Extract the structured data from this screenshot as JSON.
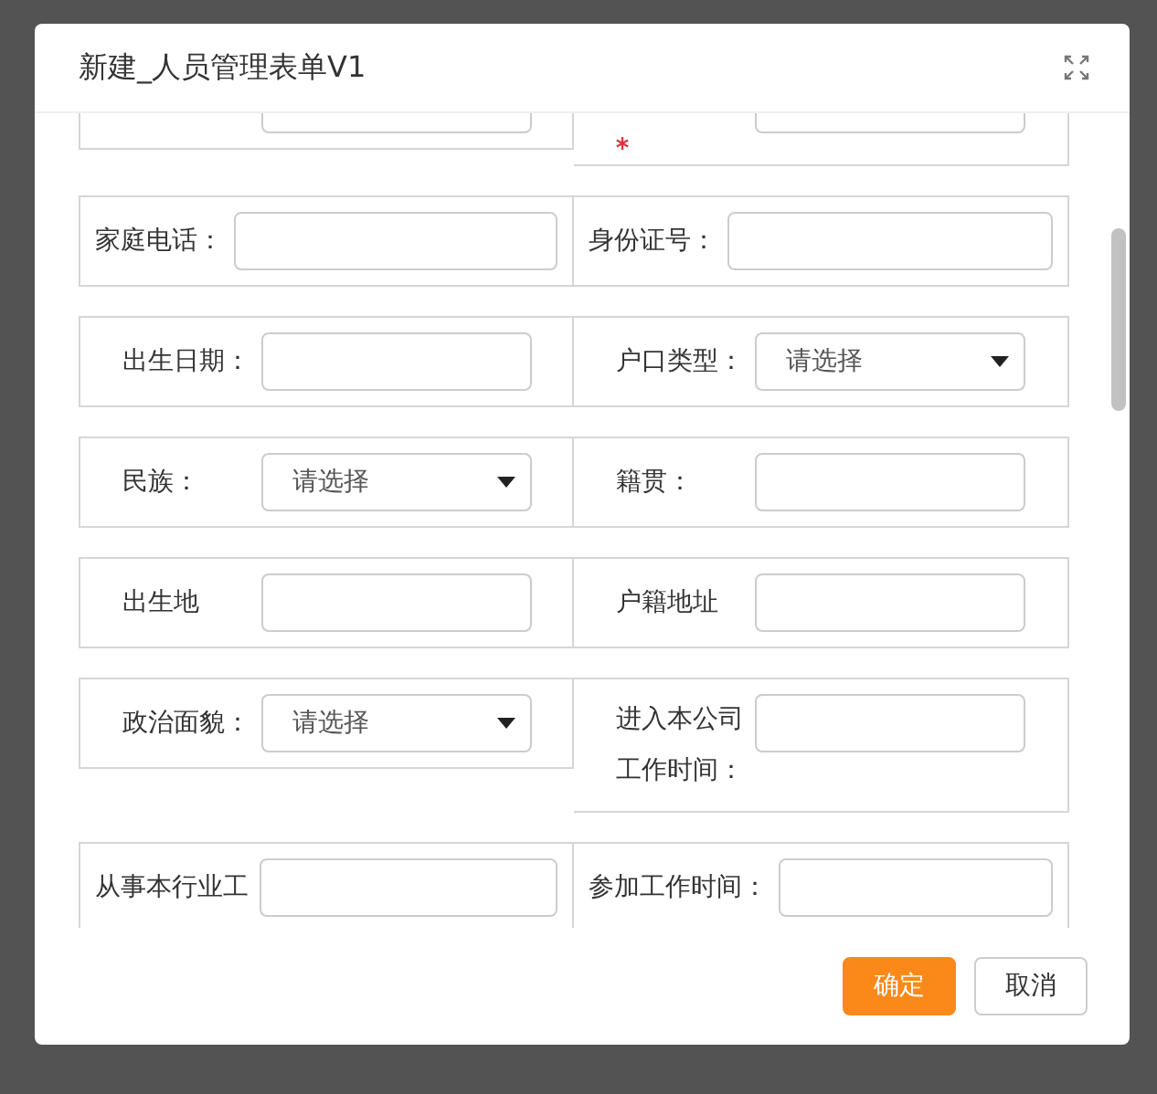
{
  "dialog": {
    "title": "新建_人员管理表单V1"
  },
  "rows": [
    {
      "cells": [
        {
          "kind": "input",
          "wide": false,
          "required": false
        },
        {
          "kind": "input",
          "wide": false,
          "required": true
        }
      ]
    },
    {
      "cells": [
        {
          "label": "家庭电话：",
          "kind": "input",
          "wide": true,
          "required": false
        },
        {
          "label": "身份证号：",
          "kind": "input",
          "wide": true,
          "required": false
        }
      ]
    },
    {
      "cells": [
        {
          "label": "出生日期：",
          "kind": "input",
          "wide": false,
          "required": false
        },
        {
          "label": "户口类型：",
          "kind": "select",
          "placeholder": "请选择",
          "wide": false,
          "required": false
        }
      ]
    },
    {
      "cells": [
        {
          "label": "民族：",
          "kind": "select",
          "placeholder": "请选择",
          "wide": false,
          "required": false
        },
        {
          "label": "籍贯：",
          "kind": "input",
          "wide": false,
          "required": false
        }
      ]
    },
    {
      "cells": [
        {
          "label": "出生地",
          "kind": "input",
          "wide": false,
          "required": false
        },
        {
          "label": "户籍地址",
          "kind": "input",
          "wide": false,
          "required": false
        }
      ]
    },
    {
      "cells": [
        {
          "label": "政治面貌：",
          "kind": "select",
          "placeholder": "请选择",
          "wide": false,
          "required": false
        },
        {
          "label": "进入本公司工作时间：",
          "kind": "input",
          "wide": false,
          "required": false
        }
      ]
    },
    {
      "cells": [
        {
          "label": "从事本行业工",
          "kind": "input",
          "wide": true,
          "required": false
        },
        {
          "label": "参加工作时间：",
          "kind": "input",
          "wide": true,
          "required": false
        }
      ]
    }
  ],
  "buttons": [
    {
      "label": "确定",
      "kind": "primary"
    },
    {
      "label": "取消",
      "kind": "default"
    }
  ]
}
